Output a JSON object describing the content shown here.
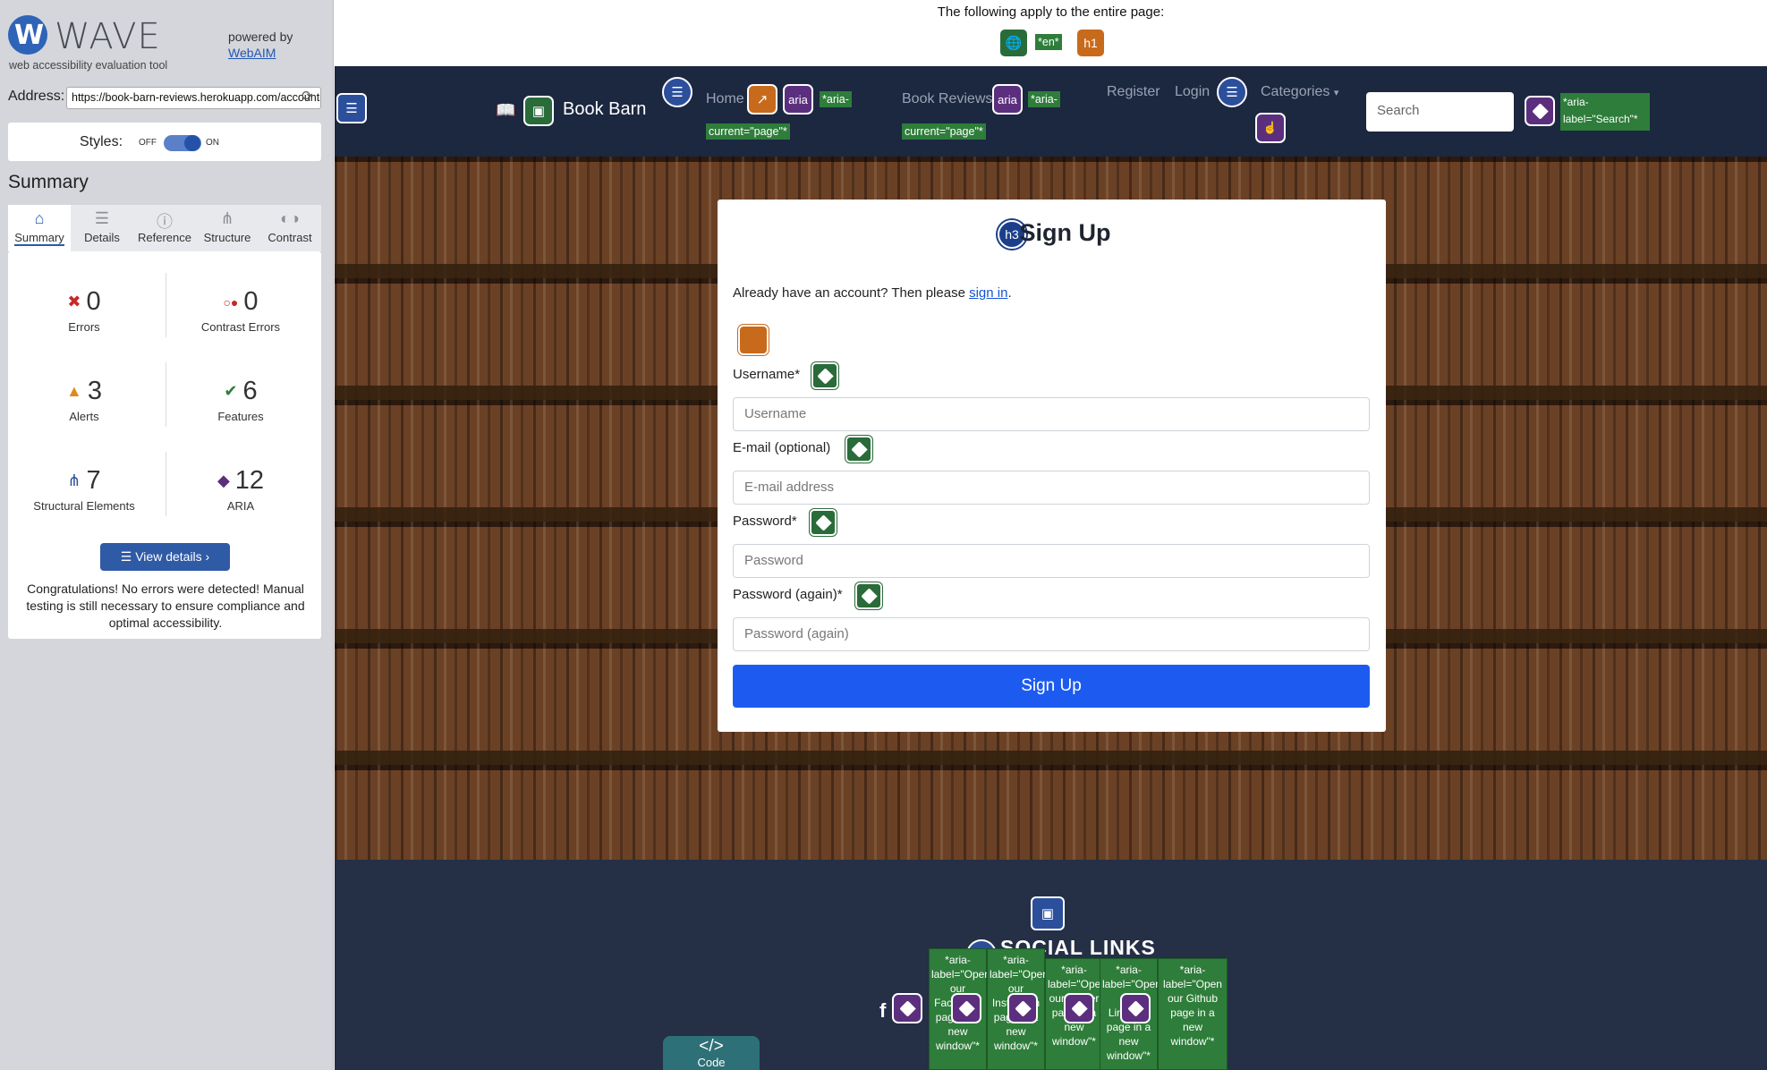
{
  "wave": {
    "brand": "WAVE",
    "tagline": "web accessibility evaluation tool",
    "powered_by": "powered by",
    "webaim": "WebAIM",
    "address_label": "Address:",
    "address_value": "https://book-barn-reviews.herokuapp.com/accounts/signup/",
    "styles_label": "Styles:",
    "styles_off": "OFF",
    "styles_on": "ON",
    "summary_heading": "Summary",
    "tabs": [
      {
        "label": "Summary",
        "icon": "home-icon",
        "active": true
      },
      {
        "label": "Details",
        "icon": "list-icon",
        "active": false
      },
      {
        "label": "Reference",
        "icon": "info-icon",
        "active": false
      },
      {
        "label": "Structure",
        "icon": "hierarchy-icon",
        "active": false
      },
      {
        "label": "Contrast",
        "icon": "contrast-icon",
        "active": false
      }
    ],
    "stats": [
      {
        "value": "0",
        "label": "Errors",
        "icon": "error-icon",
        "color": "#c62828"
      },
      {
        "value": "0",
        "label": "Contrast Errors",
        "icon": "contrast-error-icon",
        "color": "#c62828"
      },
      {
        "value": "3",
        "label": "Alerts",
        "icon": "alert-icon",
        "color": "#e08a1e"
      },
      {
        "value": "6",
        "label": "Features",
        "icon": "feature-icon",
        "color": "#2e7d3a"
      },
      {
        "value": "7",
        "label": "Structural Elements",
        "icon": "structure-icon",
        "color": "#2c4f9c"
      },
      {
        "value": "12",
        "label": "ARIA",
        "icon": "aria-icon",
        "color": "#5b2f7e"
      }
    ],
    "view_details": "View details ›",
    "congrats": "Congratulations! No errors were detected! Manual testing is still necessary to ensure compliance and optimal accessibility."
  },
  "page": {
    "top_note": "The following apply to the entire page:",
    "lang_label": "*en*",
    "h1_label": "h1",
    "nav": {
      "brand": "Book Barn",
      "home": "Home",
      "book_reviews": "Book Reviews",
      "register": "Register",
      "login": "Login",
      "categories": "Categories",
      "search_placeholder": "Search",
      "aria_current_1": "*aria-",
      "aria_current_2": "current=\"page\"*",
      "aria_label_search_1": "*aria-",
      "aria_label_search_2": "label=\"Search\"*",
      "aria_badge": "aria"
    },
    "form": {
      "h3_badge": "h3",
      "title": "Sign Up",
      "signin_prefix": "Already have an account? Then please",
      "signin_link": "sign in",
      "signin_suffix": ".",
      "fields": [
        {
          "label": "Username*",
          "placeholder": "Username"
        },
        {
          "label": "E-mail (optional)",
          "placeholder": "E-mail address"
        },
        {
          "label": "Password*",
          "placeholder": "Password"
        },
        {
          "label": "Password (again)*",
          "placeholder": "Password (again)"
        }
      ],
      "submit": "Sign Up"
    },
    "footer": {
      "h4_badge": "h4",
      "social_title": "SOCIAL LINKS",
      "facebook": "f",
      "tags": [
        "*aria-label=\"Open our Facebook page in a new window\"*",
        "*aria-label=\"Open our Instagram page in a new window\"*",
        "*aria-label=\"Open our Twitter page in a new window\"*",
        "*aria-label=\"Open our LinkedIn page in a new window\"*",
        "*aria-label=\"Open our Github page in a new window\"*"
      ],
      "code_tab_icon": "</>",
      "code_tab": "Code"
    }
  }
}
